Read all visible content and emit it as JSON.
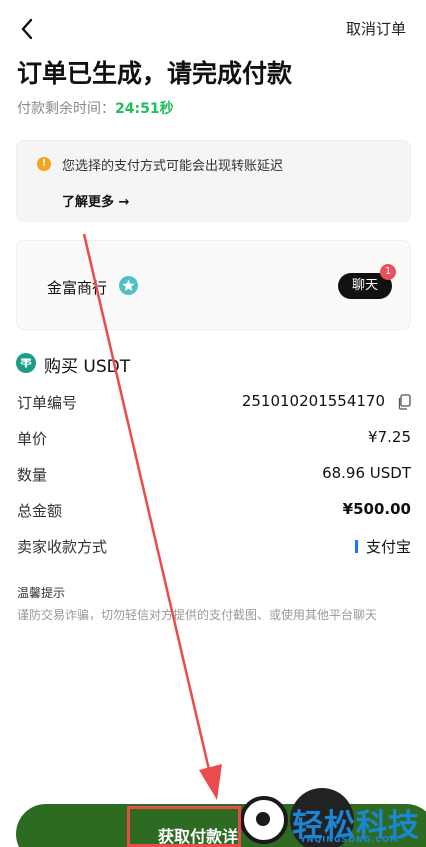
{
  "header": {
    "back_icon": "chevron-left-icon",
    "cancel_label": "取消订单"
  },
  "page": {
    "title": "订单已生成，请完成付款",
    "timer_label": "付款剩余时间：",
    "timer_value": "24:51秒"
  },
  "notice": {
    "text": "您选择的支付方式可能会出现转账延迟",
    "learn_more": "了解更多 →"
  },
  "merchant": {
    "name": "金富商行",
    "chat_label": "聊天",
    "chat_badge": "1"
  },
  "order": {
    "buy_label": "购买 USDT",
    "rows": [
      {
        "key": "订单编号",
        "value": "251010201554170"
      },
      {
        "key": "单价",
        "value": "¥7.25"
      },
      {
        "key": "数量",
        "value": "68.96 USDT"
      },
      {
        "key": "总金额",
        "value": "¥500.00"
      },
      {
        "key": "卖家收款方式",
        "value": "支付宝"
      }
    ]
  },
  "tips": {
    "title": "温馨提示",
    "body": "谨防交易诈骗，切勿轻信对方提供的支付截图、或使用其他平台聊天"
  },
  "bottom": {
    "button_label": "获取付款详"
  },
  "watermark": {
    "text": "轻松科技",
    "sub": "YNQINGSONG.COM"
  },
  "colors": {
    "timer": "#1fbf5b",
    "primary_button": "#2e6b22",
    "annotation": "#ea4b4b",
    "watermark": "#1b86d4"
  }
}
